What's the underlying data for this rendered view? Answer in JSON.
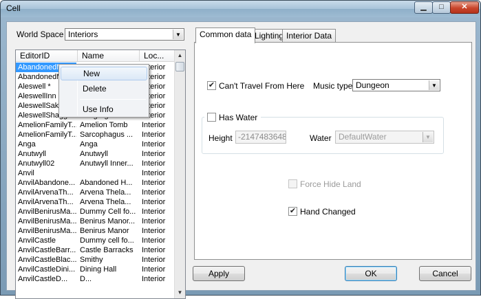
{
  "window": {
    "title": "Cell",
    "minimize_icon": "minimize-icon",
    "maximize_icon": "maximize-icon",
    "close_icon": "close-icon"
  },
  "world_space": {
    "label": "World Space",
    "value": "Interiors"
  },
  "list": {
    "columns": [
      "EditorID",
      "Name",
      "Loc..."
    ],
    "rows": [
      [
        "AbandonedM",
        "",
        "Interior"
      ],
      [
        "AbandonedM",
        "",
        "Interior"
      ],
      [
        "Aleswell *",
        "",
        "Interior"
      ],
      [
        "AleswellInn",
        "",
        "Interior"
      ],
      [
        "AleswellSake",
        "",
        "Interior"
      ],
      [
        "AleswellShagg",
        "Shagrogs Shack",
        "Interior"
      ],
      [
        "AmelionFamilyT...",
        "Amelion Tomb",
        "Interior"
      ],
      [
        "AmelionFamilyT...",
        "Sarcophagus ...",
        "Interior"
      ],
      [
        "Anga",
        "Anga",
        "Interior"
      ],
      [
        "Anutwyll",
        "Anutwyll",
        "Interior"
      ],
      [
        "Anutwyll02",
        "Anutwyll Inner...",
        "Interior"
      ],
      [
        "Anvil",
        "",
        "Interior"
      ],
      [
        "AnvilAbandone...",
        "Abandoned H...",
        "Interior"
      ],
      [
        "AnvilArvenaTh...",
        "Arvena Thela...",
        "Interior"
      ],
      [
        "AnvilArvenaTh...",
        "Arvena Thela...",
        "Interior"
      ],
      [
        "AnvilBenirusMa...",
        "Dummy Cell fo...",
        "Interior"
      ],
      [
        "AnvilBenirusMa...",
        "Benirus Manor...",
        "Interior"
      ],
      [
        "AnvilBenirusMa...",
        "Benirus Manor",
        "Interior"
      ],
      [
        "AnvilCastle",
        "Dummy cell fo...",
        "Interior"
      ],
      [
        "AnvilCastleBarr...",
        "Castle Barracks",
        "Interior"
      ],
      [
        "AnvilCastleBlac...",
        "Smithy",
        "Interior"
      ],
      [
        "AnvilCastleDini...",
        "Dining Hall",
        "Interior"
      ],
      [
        "AnvilCastleD...",
        "D...",
        "Interior"
      ]
    ]
  },
  "context_menu": {
    "items": [
      "New",
      "Delete",
      "Use Info"
    ]
  },
  "tabs": [
    "Common data",
    "Lighting",
    "Interior Data"
  ],
  "common": {
    "cant_travel_label": "Can't Travel From Here",
    "cant_travel_checked": true,
    "music_type_label": "Music type",
    "music_type_value": "Dungeon",
    "has_water_label": "Has Water",
    "has_water_checked": false,
    "height_label": "Height",
    "height_value": "-2147483648.0",
    "water_label": "Water",
    "water_value": "DefaultWater",
    "force_hide_land_label": "Force Hide Land",
    "force_hide_land_checked": false,
    "hand_changed_label": "Hand Changed",
    "hand_changed_checked": true
  },
  "buttons": {
    "apply": "Apply",
    "ok": "OK",
    "cancel": "Cancel"
  },
  "glyphs": {
    "check": "✔",
    "dropdown": "▼",
    "up": "▲",
    "down": "▼"
  }
}
